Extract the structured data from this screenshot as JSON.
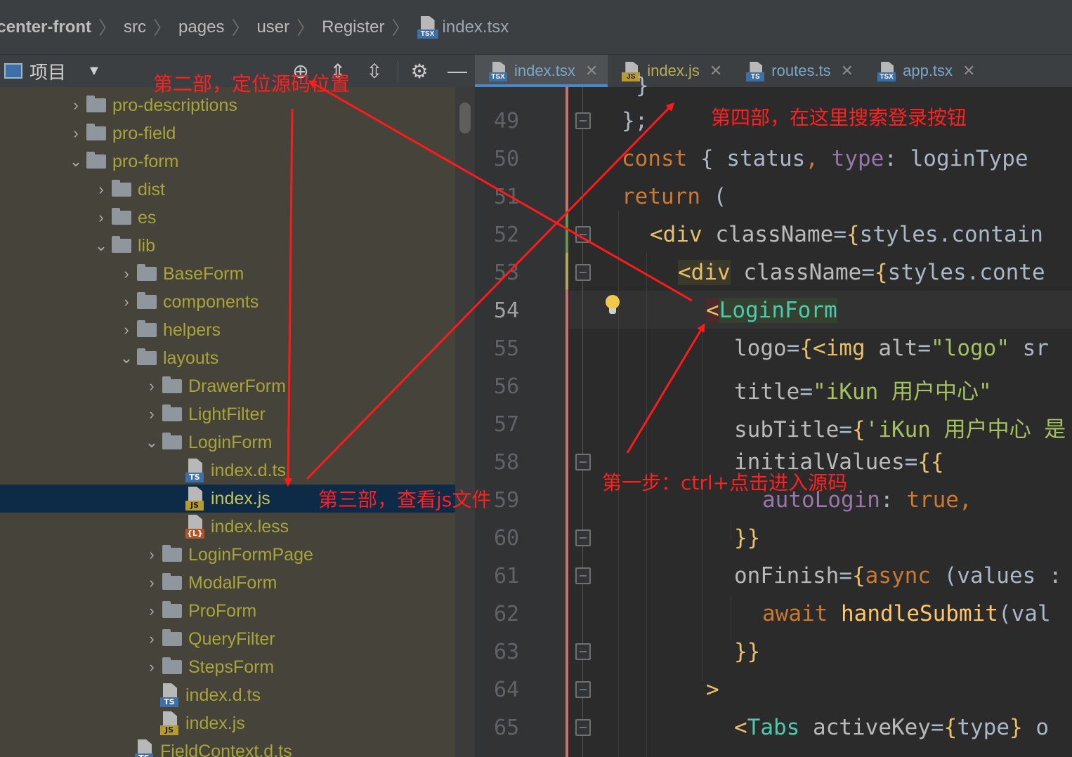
{
  "breadcrumb": [
    "rcenter-front",
    "src",
    "pages",
    "user",
    "Register",
    "index.tsx"
  ],
  "project_panel": {
    "title": "项目",
    "tree": [
      {
        "label": "pro-descriptions",
        "kind": "folder",
        "expanded": false
      },
      {
        "label": "pro-field",
        "kind": "folder",
        "expanded": false
      },
      {
        "label": "pro-form",
        "kind": "folder",
        "expanded": true
      },
      {
        "label": "dist",
        "kind": "folder",
        "expanded": false
      },
      {
        "label": "es",
        "kind": "folder",
        "expanded": false
      },
      {
        "label": "lib",
        "kind": "folder",
        "expanded": true
      },
      {
        "label": "BaseForm",
        "kind": "folder",
        "expanded": false
      },
      {
        "label": "components",
        "kind": "folder",
        "expanded": false
      },
      {
        "label": "helpers",
        "kind": "folder",
        "expanded": false
      },
      {
        "label": "layouts",
        "kind": "folder",
        "expanded": true
      },
      {
        "label": "DrawerForm",
        "kind": "folder",
        "expanded": false
      },
      {
        "label": "LightFilter",
        "kind": "folder",
        "expanded": false
      },
      {
        "label": "LoginForm",
        "kind": "folder",
        "expanded": true
      },
      {
        "label": "index.d.ts",
        "kind": "file",
        "badge": "TS"
      },
      {
        "label": "index.js",
        "kind": "file",
        "badge": "JS",
        "selected": true
      },
      {
        "label": "index.less",
        "kind": "file",
        "badge": "{L}"
      },
      {
        "label": "LoginFormPage",
        "kind": "folder",
        "expanded": false
      },
      {
        "label": "ModalForm",
        "kind": "folder",
        "expanded": false
      },
      {
        "label": "ProForm",
        "kind": "folder",
        "expanded": false
      },
      {
        "label": "QueryFilter",
        "kind": "folder",
        "expanded": false
      },
      {
        "label": "StepsForm",
        "kind": "folder",
        "expanded": false
      },
      {
        "label": "index.d.ts",
        "kind": "file",
        "badge": "TS"
      },
      {
        "label": "index.js",
        "kind": "file",
        "badge": "JS"
      },
      {
        "label": "FieldContext.d.ts",
        "kind": "file",
        "badge": "TS"
      }
    ]
  },
  "editor_tabs": [
    {
      "label": "index.tsx",
      "badge": "TSX",
      "active": true
    },
    {
      "label": "index.js",
      "badge": "JS",
      "active": false
    },
    {
      "label": "routes.ts",
      "badge": "TS",
      "active": false
    },
    {
      "label": "app.tsx",
      "badge": "TSX",
      "active": false
    }
  ],
  "code": {
    "line_numbers": [
      "49",
      "50",
      "51",
      "52",
      "53",
      "54",
      "55",
      "56",
      "57",
      "58",
      "59",
      "60",
      "61",
      "62",
      "63",
      "64",
      "65"
    ],
    "current_line": "54",
    "top_partial": "};"
  },
  "annotations": {
    "step1": "第一步：ctrl+点击进入源码",
    "step2": "第二部，定位源码位置",
    "step3": "第三部，查看js文件",
    "step4": "第四部，在这里搜索登录按钮"
  },
  "colors": {
    "annotation": "#ff2020",
    "tree_text": "#a9a43a",
    "selection": "#0d2a47",
    "keyword": "#cc7832",
    "jsx_tag": "#e8bf6a",
    "component": "#4ec9b0",
    "string": "#a5c261",
    "accent": "#4a88c7"
  },
  "icons": {
    "locate": "crosshair-icon",
    "expand_all": "expand-all-icon",
    "collapse_all": "collapse-all-icon",
    "settings": "gear-icon",
    "hide": "minus-icon"
  }
}
